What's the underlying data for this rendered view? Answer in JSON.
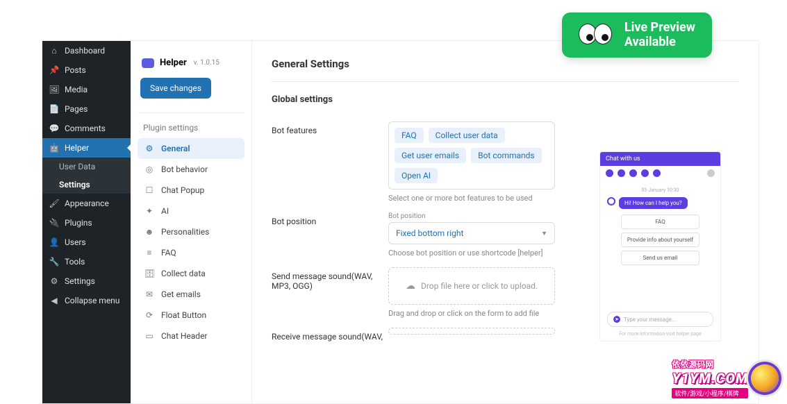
{
  "live_preview": {
    "line1": "Live Preview",
    "line2": "Available"
  },
  "wp_menu": [
    {
      "id": "dashboard",
      "icon": "⌂",
      "label": "Dashboard"
    },
    {
      "id": "posts",
      "icon": "📌",
      "label": "Posts"
    },
    {
      "id": "media",
      "icon": "🖼",
      "label": "Media"
    },
    {
      "id": "pages",
      "icon": "📄",
      "label": "Pages"
    },
    {
      "id": "comments",
      "icon": "💬",
      "label": "Comments"
    },
    {
      "id": "helper",
      "icon": "🤖",
      "label": "Helper",
      "active": true
    },
    {
      "id": "appearance",
      "icon": "🖌",
      "label": "Appearance"
    },
    {
      "id": "plugins",
      "icon": "🔌",
      "label": "Plugins"
    },
    {
      "id": "users",
      "icon": "👤",
      "label": "Users"
    },
    {
      "id": "tools",
      "icon": "🔧",
      "label": "Tools"
    },
    {
      "id": "settings",
      "icon": "⚙",
      "label": "Settings"
    },
    {
      "id": "collapse",
      "icon": "◀",
      "label": "Collapse menu"
    }
  ],
  "wp_sub": {
    "user_data": "User Data",
    "settings": "Settings"
  },
  "plugin": {
    "name": "Helper",
    "version": "v. 1.0.15",
    "save": "Save changes",
    "settings_heading": "Plugin settings",
    "items": [
      {
        "id": "general",
        "icon": "⚙",
        "label": "General",
        "active": true
      },
      {
        "id": "behavior",
        "icon": "◎",
        "label": "Bot behavior"
      },
      {
        "id": "popup",
        "icon": "☐",
        "label": "Chat Popup"
      },
      {
        "id": "ai",
        "icon": "✦",
        "label": "AI"
      },
      {
        "id": "personalities",
        "icon": "☻",
        "label": "Personalities"
      },
      {
        "id": "faq",
        "icon": "≡",
        "label": "FAQ"
      },
      {
        "id": "collect",
        "icon": "🗄",
        "label": "Collect data"
      },
      {
        "id": "emails",
        "icon": "✉",
        "label": "Get emails"
      },
      {
        "id": "float",
        "icon": "⟳",
        "label": "Float Button"
      },
      {
        "id": "header",
        "icon": "▭",
        "label": "Chat Header"
      }
    ]
  },
  "content": {
    "title": "General Settings",
    "section": "Global settings",
    "features": {
      "label": "Bot features",
      "chips": [
        "FAQ",
        "Collect user data",
        "Get user emails",
        "Bot commands",
        "Open AI"
      ],
      "hint": "Select one or more bot features to be used"
    },
    "position": {
      "label": "Bot position",
      "mini": "Bot position",
      "value": "Fixed bottom right",
      "hint": "Choose bot position or use shortcode [helper]"
    },
    "send_sound": {
      "label": "Send message sound(WAV, MP3, OGG)",
      "drop": "Drop file here or click to upload.",
      "hint": "Drag and drop or click on the form to add file"
    },
    "recv_sound": {
      "label": "Receive message sound(WAV,"
    }
  },
  "preview": {
    "header": "Chat with us",
    "time": "05 January 10:30",
    "bubble": "Hi! How can I help you?",
    "opts": [
      "FAQ",
      "Provide info about yourself",
      "Send us email"
    ],
    "placeholder": "Type your message...",
    "footer": "For more information visit helper page"
  },
  "watermark": {
    "brand": "依依源码网",
    "domain": "Y1YM.COM",
    "tags": "软件/游戏/小程序/棋牌"
  }
}
